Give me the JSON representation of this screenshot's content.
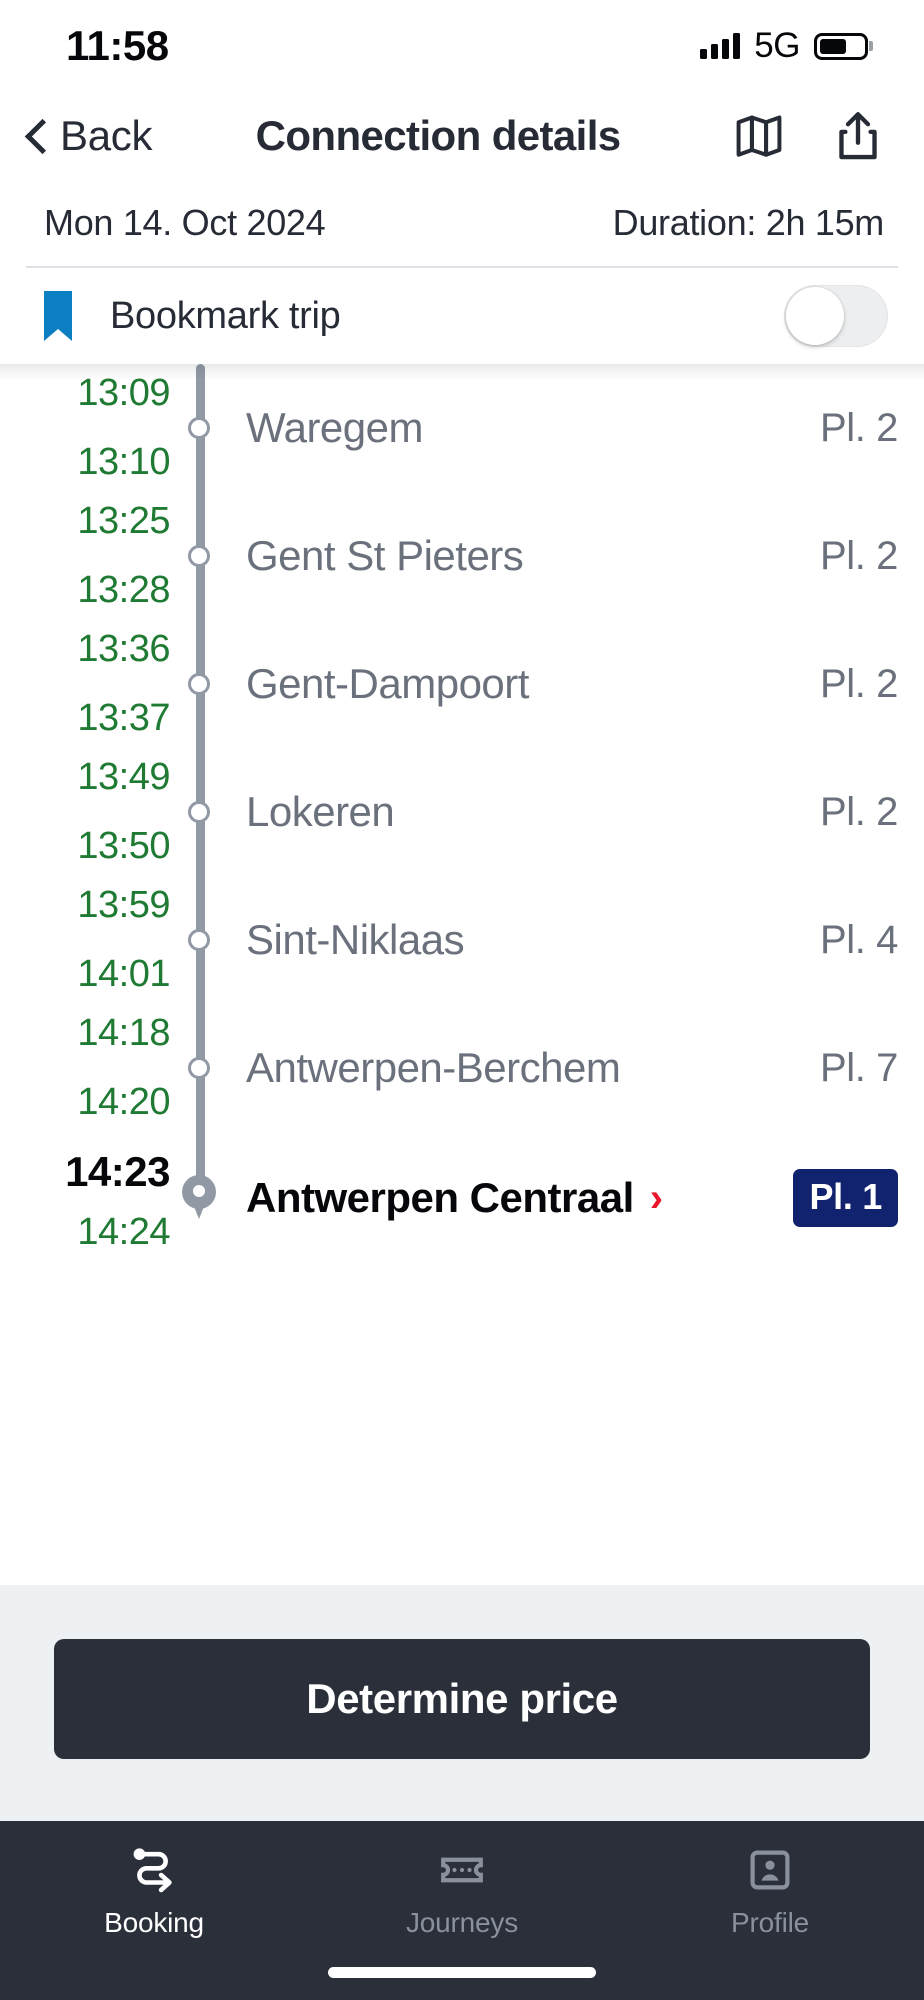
{
  "status_bar": {
    "time": "11:58",
    "network": "5G",
    "signal_icon": "signal-bars-icon",
    "battery_icon": "battery-icon"
  },
  "nav": {
    "back_label": "Back",
    "back_icon": "chevron-left-icon",
    "title": "Connection details",
    "map_icon": "map-icon",
    "share_icon": "share-icon"
  },
  "trip_meta": {
    "date": "Mon 14. Oct 2024",
    "duration": "Duration: 2h 15m"
  },
  "bookmark": {
    "icon": "bookmark-ribbon-icon",
    "label": "Bookmark trip",
    "toggle_state": "off"
  },
  "colors": {
    "time_green": "#1f7a33",
    "station_gray": "#6b717c",
    "rail_gray": "#9199a5",
    "bookmark_blue": "#0b7fc1",
    "badge_navy": "#11226e",
    "chevron_red": "#e8172b",
    "button_dark": "#2a2f3a",
    "cta_background": "#edf1f4"
  },
  "timeline": {
    "stops": [
      {
        "arrival": "13:09",
        "departure": "13:10",
        "name": "Waregem",
        "platform": "Pl. 2",
        "node_icon": "stop-circle-icon",
        "is_destination": false
      },
      {
        "arrival": "13:25",
        "departure": "13:28",
        "name": "Gent St Pieters",
        "platform": "Pl. 2",
        "node_icon": "stop-circle-icon",
        "is_destination": false
      },
      {
        "arrival": "13:36",
        "departure": "13:37",
        "name": "Gent-Dampoort",
        "platform": "Pl. 2",
        "node_icon": "stop-circle-icon",
        "is_destination": false
      },
      {
        "arrival": "13:49",
        "departure": "13:50",
        "name": "Lokeren",
        "platform": "Pl. 2",
        "node_icon": "stop-circle-icon",
        "is_destination": false
      },
      {
        "arrival": "13:59",
        "departure": "14:01",
        "name": "Sint-Niklaas",
        "platform": "Pl. 4",
        "node_icon": "stop-circle-icon",
        "is_destination": false
      },
      {
        "arrival": "14:18",
        "departure": "14:20",
        "name": "Antwerpen-Berchem",
        "platform": "Pl. 7",
        "node_icon": "stop-circle-icon",
        "is_destination": false
      },
      {
        "arrival": "14:23",
        "departure": "14:24",
        "name": "Antwerpen Centraal",
        "platform": "Pl. 1",
        "node_icon": "map-pin-icon",
        "detail_chevron": "›",
        "is_destination": true
      }
    ]
  },
  "cta": {
    "determine_price_label": "Determine price"
  },
  "tabbar": {
    "items": [
      {
        "label": "Booking",
        "icon": "route-arrow-icon",
        "active": true
      },
      {
        "label": "Journeys",
        "icon": "ticket-icon",
        "active": false
      },
      {
        "label": "Profile",
        "icon": "id-card-icon",
        "active": false
      }
    ]
  }
}
